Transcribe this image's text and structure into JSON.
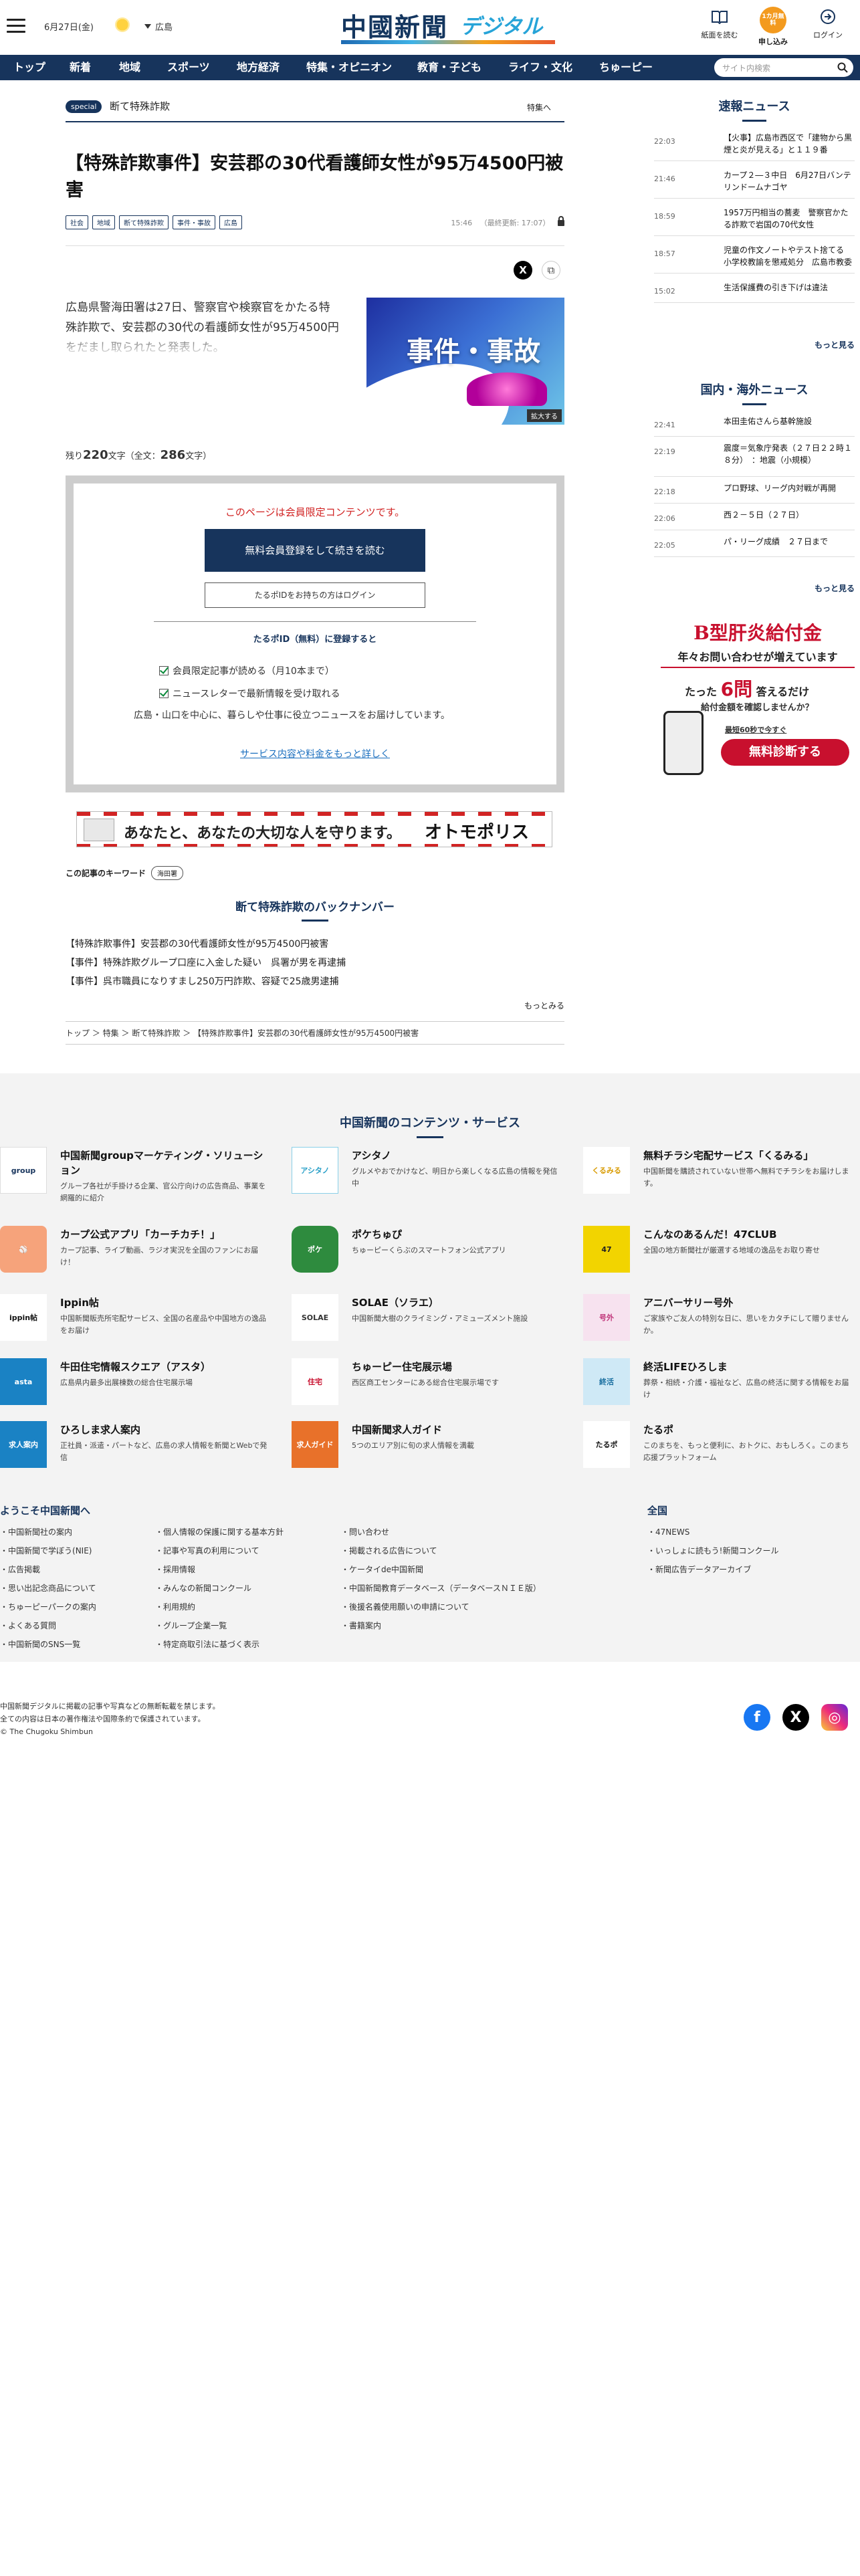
{
  "header": {
    "date": "6月27日(金)",
    "region": "広島",
    "logo_kanji": "中國新聞",
    "logo_digital": "デジタル",
    "buttons": [
      {
        "label": "紙面を読む",
        "icon": "newspaper-icon"
      },
      {
        "label": "申し込み",
        "icon": "signup-badge-icon",
        "badge": "1カ月無料"
      },
      {
        "label": "ログイン",
        "icon": "login-icon"
      }
    ]
  },
  "nav": {
    "items": [
      "トップ",
      "新着",
      "地域",
      "スポーツ",
      "地方経済",
      "特集・オピニオン",
      "教育・子ども",
      "ライフ・文化",
      "ちゅーピー"
    ],
    "search_placeholder": "サイト内検索"
  },
  "article": {
    "special_badge": "special",
    "special_title": "断て特殊詐欺",
    "special_link": "特集へ",
    "title": "【特殊詐欺事件】安芸郡の30代看護師女性が95万4500円被害",
    "tags": [
      "社会",
      "地域",
      "断て特殊詐欺",
      "事件・事故",
      "広島"
    ],
    "time": "15:46",
    "updated": "（最終更新: 17:07）",
    "lead": "広島県警海田署は27日、警察官や検察官をかたる特殊詐欺で、安芸郡の30代の看護師女性が95万4500円をだまし取られたと発表した。",
    "photo_text": "事件・事故",
    "enlarge": "拡大する",
    "remaining_prefix": "残り",
    "remaining_chars": "220",
    "remaining_mid": "文字（全文：",
    "total_chars": "286",
    "remaining_suffix": "文字）"
  },
  "paywall": {
    "message": "このページは会員限定コンテンツです。",
    "register_button": "無料会員登録をして続きを読む",
    "login_button": "たるポIDをお持ちの方はログイン",
    "register_heading": "たるポID（無料）に登録すると",
    "benefits": [
      "会員限定記事が読める（月10本まで）",
      "ニュースレターで最新情報を受け取れる"
    ],
    "benefit_note": "広島・山口を中心に、暮らしや仕事に役立つニュースをお届けしています。",
    "more_link": "サービス内容や料金をもっと詳しく"
  },
  "ad_banner": {
    "text": "あなたと、あなたの大切な人を守ります。",
    "brand": "オトモポリス"
  },
  "keywords": {
    "label": "この記事のキーワード",
    "items": [
      "海田署"
    ]
  },
  "backnumber": {
    "heading": "断て特殊詐欺のバックナンバー",
    "items": [
      "【特殊詐欺事件】安芸郡の30代看護師女性が95万4500円被害",
      "【事件】特殊詐欺グループ口座に入金した疑い　呉署が男を再逮捕",
      "【事件】呉市職員になりすまし250万円詐欺、容疑で25歳男逮捕"
    ],
    "more": "もっとみる"
  },
  "breadcrumb": [
    "トップ",
    "特集",
    "断て特殊詐欺",
    "【特殊詐欺事件】安芸郡の30代看護師女性が95万4500円被害"
  ],
  "sidebar": {
    "flash_heading": "速報ニュース",
    "flash": [
      {
        "time": "22:03",
        "text": "【火事】広島市西区で「建物から黒煙と炎が見える」と１１９番"
      },
      {
        "time": "21:46",
        "text": "カープ２―３中日　6月27日バンテリンドームナゴヤ"
      },
      {
        "time": "18:59",
        "text": "1957万円相当の蕎麦　警察官かたる詐欺で岩国の70代女性"
      },
      {
        "time": "18:57",
        "text": "児童の作文ノートやテスト捨てる　小学校教諭を懲戒処分　広島市教委"
      },
      {
        "time": "15:02",
        "text": "生活保護費の引き下げは違法"
      }
    ],
    "flash_more": "もっと見る",
    "world_heading": "国内・海外ニュース",
    "world": [
      {
        "time": "22:41",
        "text": "本田圭佑さんら基幹施設"
      },
      {
        "time": "22:19",
        "text": "震度＝気象庁発表（２７日２２時１８分）　：地震（小規模）"
      },
      {
        "time": "22:18",
        "text": "プロ野球、リーグ内対戦が再開"
      },
      {
        "time": "22:06",
        "text": "西２－５日（２７日）"
      },
      {
        "time": "22:05",
        "text": "パ・リーグ成績　２７日まで"
      }
    ],
    "world_more": "もっと見る",
    "ad": {
      "headline": "B型肝炎給付金",
      "sub": "年々お問い合わせが増えています",
      "line1_pre": "たった",
      "line1_em": "6問",
      "line1_post": "答えるだけ",
      "line2": "給付金額を確認しませんか？",
      "line3": "最短60秒で今すぐ",
      "cta": "無料診断する"
    }
  },
  "services": {
    "heading": "中国新聞のコンテンツ・サービス",
    "items": [
      {
        "name": "中国新聞groupマーケティング・ソリューション",
        "desc": "グループ各社が手掛ける企業、官公庁向けの広告商品、事業を網羅的に紹介"
      },
      {
        "name": "アシタノ",
        "desc": "グルメやおでかけなど、明日から楽しくなる広島の情報を発信中"
      },
      {
        "name": "無料チラシ宅配サービス「くるみる」",
        "desc": "中国新聞を購読されていない世帯へ無料でチラシをお届けします。"
      },
      {
        "name": "カープ公式アプリ「カーチカチ！」",
        "desc": "カープ記事、ライブ動画、ラジオ実況を全国のファンにお届け！"
      },
      {
        "name": "ポケちゅぴ",
        "desc": "ちゅーピーくらぶのスマートフォン公式アプリ"
      },
      {
        "name": "こんなのあるんだ！47CLUB",
        "desc": "全国の地方新聞社が厳選する地域の逸品をお取り寄せ"
      },
      {
        "name": "Ippin帖",
        "desc": "中国新聞販売所宅配サービス、全国の名産品や中国地方の逸品をお届け"
      },
      {
        "name": "SOLAE（ソラエ）",
        "desc": "中国新聞大樹のクライミング・アミューズメント施設"
      },
      {
        "name": "アニバーサリー号外",
        "desc": "ご家族やご友人の特別な日に、思いをカタチにして贈りませんか。"
      },
      {
        "name": "牛田住宅情報スクエア（アスタ）",
        "desc": "広島県内最多出展棟数の総合住宅展示場"
      },
      {
        "name": "ちゅーピー住宅展示場",
        "desc": "西区商工センターにある総合住宅展示場です"
      },
      {
        "name": "終活LIFEひろしま",
        "desc": "葬祭・相続・介護・福祉など、広島の終活に関する情報をお届け"
      },
      {
        "name": "ひろしま求人案内",
        "desc": "正社員・派遣・パートなど、広島の求人情報を新聞とWebで発信"
      },
      {
        "name": "中国新聞求人ガイド",
        "desc": "5つのエリア別に旬の求人情報を満載"
      },
      {
        "name": "たるポ",
        "desc": "このまちを、もっと便利に、おトクに、おもしろく。このまち応援プラットフォーム"
      }
    ]
  },
  "footer": {
    "welcome_heading": "ようこそ中国新聞へ",
    "zenkoku_heading": "全国",
    "col1": [
      "中国新聞社の案内",
      "中国新聞で学ぼう(NIE)",
      "広告掲載",
      "思い出記念商品について",
      "ちゅーピーパークの案内",
      "よくある質問",
      "中国新聞のSNS一覧"
    ],
    "col2": [
      "個人情報の保護に関する基本方針",
      "記事や写真の利用について",
      "採用情報",
      "みんなの新聞コンクール",
      "利用規約",
      "グループ企業一覧",
      "特定商取引法に基づく表示"
    ],
    "col3": [
      "問い合わせ",
      "掲載される広告について",
      "ケータイde中国新聞",
      "中国新聞教育データベース（データベースＮＩＥ版）",
      "後援名義使用願いの申請について",
      "書籍案内"
    ],
    "col4": [
      "47NEWS",
      "いっしょに読もう!新聞コンクール",
      "新聞広告データアーカイブ"
    ],
    "copy1": "中国新聞デジタルに掲載の記事や写真などの無断転載を禁じます。",
    "copy2": "全ての内容は日本の著作権法や国際条約で保護されています。",
    "copy3": "© The Chugoku Shimbun",
    "sns": [
      {
        "icon": "facebook-icon",
        "color": "#1877f2"
      },
      {
        "icon": "x-icon",
        "color": "#000000"
      },
      {
        "icon": "instagram-icon",
        "color": "#d62976"
      }
    ]
  }
}
